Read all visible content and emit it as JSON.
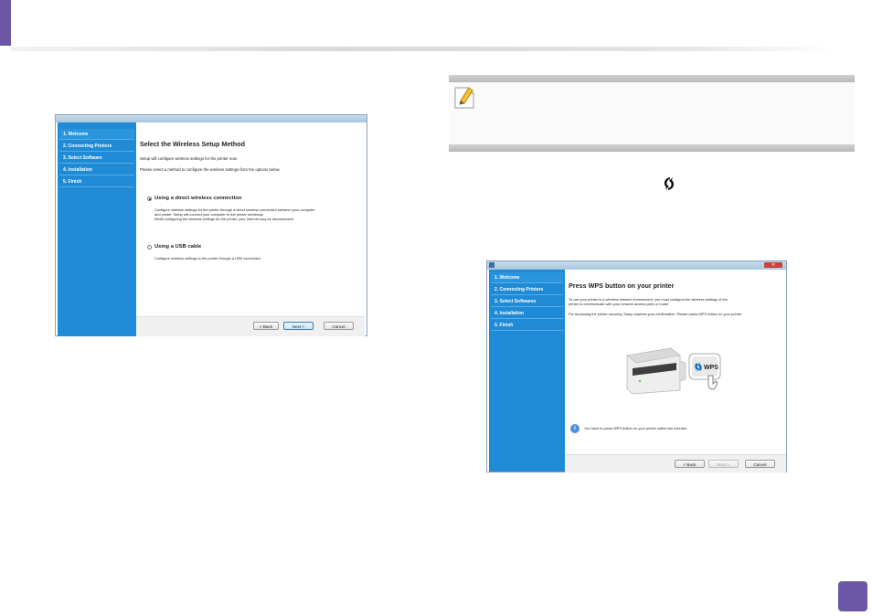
{
  "colors": {
    "accent": "#6b57a5",
    "installer_sidebar": "#1f8ad6",
    "wps_badge_accent": "#1a73c9"
  },
  "icons": {
    "note": "note-pencil-icon",
    "wps": "wps-icon",
    "info": "info-icon"
  },
  "installer1": {
    "sidebar": [
      "1. Welcome",
      "2. Connecting Printers",
      "3. Select Software",
      "4. Installation",
      "5. Finish"
    ],
    "title": "Select the Wireless Setup Method",
    "line1": "Setup will configure wireless settings for the printer now.",
    "line2": "Please select a method to configure the wireless settings from the options below.",
    "option1": {
      "label": "Using a direct wireless connection",
      "desc1": "Configure wireless settings for the printer through a direct wireless connection between your computer",
      "desc2": "and printer. Setup will connect your computer to the printer wirelessly.",
      "desc3": "While configuring the wireless settings for the printer, your Internet may be disconnected."
    },
    "option2": {
      "label": "Using a USB cable",
      "desc1": "Configure wireless settings to the printer through a USB connection"
    },
    "buttons": {
      "back": "< Back",
      "next": "Next >",
      "cancel": "Cancel"
    }
  },
  "installer2": {
    "sidebar": [
      "1. Welcome",
      "2. Connecting Printers",
      "3. Select Softwares",
      "4. Installation",
      "5. Finish"
    ],
    "title": "Press WPS button on your printer",
    "line1": "To use your printer in a wireless network environment, you must configure the wireless settings of the",
    "line2": "printer to communicate with your network access point or router.",
    "line3": "For accessing the printer securely, Setup requires your confirmation. Please press WPS button on your printer.",
    "wps_label": "WPS",
    "notice": "You have to press WPS button on your printer within two minutes.",
    "buttons": {
      "back": "< Back",
      "next": "Next >",
      "cancel": "Cancel"
    }
  }
}
